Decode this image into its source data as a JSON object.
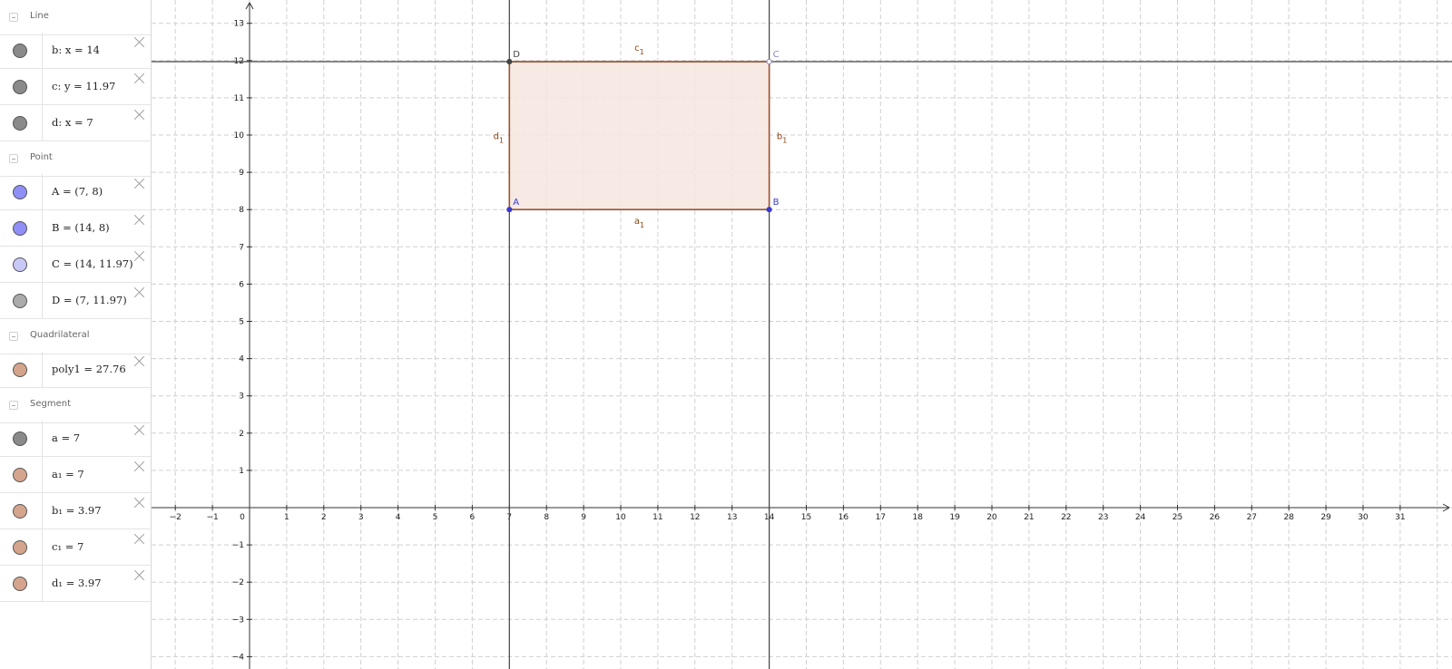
{
  "algebra": {
    "groups": [
      {
        "label": "Line",
        "items": [
          {
            "text": "b: x = 14",
            "color": "#8a8a8a"
          },
          {
            "text": "c: y = 11.97",
            "color": "#8a8a8a"
          },
          {
            "text": "d: x = 7",
            "color": "#8a8a8a"
          }
        ]
      },
      {
        "label": "Point",
        "items": [
          {
            "text": "A = (7, 8)",
            "color": "#8f8ff7"
          },
          {
            "text": "B = (14, 8)",
            "color": "#8f8ff7"
          },
          {
            "text": "C = (14, 11.97)",
            "color": "#c9c9f7"
          },
          {
            "text": "D = (7, 11.97)",
            "color": "#ababab"
          }
        ]
      },
      {
        "label": "Quadrilateral",
        "items": [
          {
            "text": "poly1 = 27.76",
            "color": "#d4a58c"
          }
        ]
      },
      {
        "label": "Segment",
        "items": [
          {
            "text": "a = 7",
            "color": "#8a8a8a"
          },
          {
            "text": "a₁ = 7",
            "color": "#d4a58c"
          },
          {
            "text": "b₁ = 3.97",
            "color": "#d4a58c"
          },
          {
            "text": "c₁ = 7",
            "color": "#d4a58c"
          },
          {
            "text": "d₁ = 3.97",
            "color": "#d4a58c"
          }
        ]
      }
    ]
  },
  "graphics": {
    "x_ticks": [
      "-2",
      "-1",
      "0",
      "1",
      "2",
      "3",
      "4",
      "5",
      "6",
      "7",
      "8",
      "9",
      "10",
      "11",
      "12",
      "13",
      "14",
      "15",
      "16",
      "17",
      "18",
      "19",
      "20",
      "21",
      "22",
      "23",
      "24",
      "25",
      "26",
      "27",
      "28",
      "29",
      "30",
      "31"
    ],
    "y_ticks": [
      "-4",
      "-3",
      "-2",
      "-1",
      "1",
      "2",
      "3",
      "4",
      "5",
      "6",
      "7",
      "8",
      "9",
      "10",
      "11",
      "12",
      "13"
    ],
    "lines": [
      {
        "name": "b",
        "type": "vertical",
        "value": 14
      },
      {
        "name": "c",
        "type": "horizontal",
        "value": 11.97
      },
      {
        "name": "d",
        "type": "vertical",
        "value": 7
      }
    ],
    "points": [
      {
        "label": "A",
        "x": 7,
        "y": 8,
        "color": "#3a3ad0"
      },
      {
        "label": "B",
        "x": 14,
        "y": 8,
        "color": "#3a3ad0"
      },
      {
        "label": "C",
        "x": 14,
        "y": 11.97,
        "color": "#8888cc"
      },
      {
        "label": "D",
        "x": 7,
        "y": 11.97,
        "color": "#444444"
      }
    ],
    "segment_labels": {
      "a1": {
        "base": "a",
        "sub": "1"
      },
      "b1": {
        "base": "b",
        "sub": "1"
      },
      "c1": {
        "base": "c",
        "sub": "1"
      },
      "d1": {
        "base": "d",
        "sub": "1"
      }
    },
    "polygon": {
      "name": "poly1",
      "fill": "#f6e6e1",
      "stroke": "#a0522d"
    }
  }
}
